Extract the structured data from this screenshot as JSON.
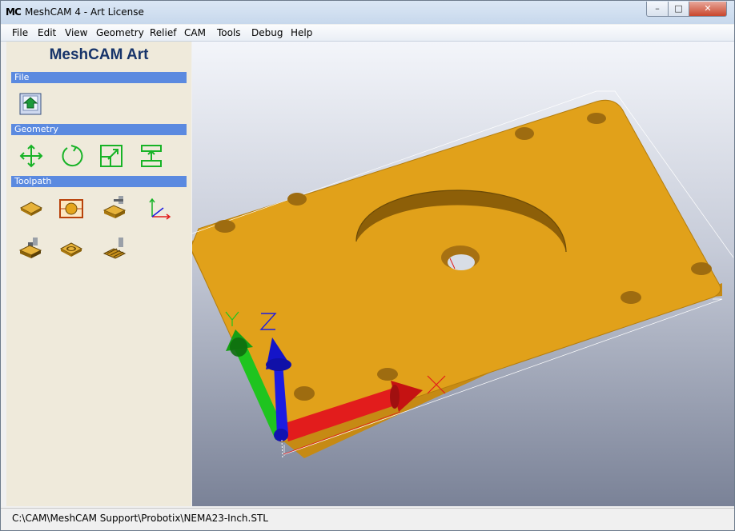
{
  "window": {
    "icon_text": "MC",
    "title": "MeshCAM 4 - Art License",
    "controls": {
      "minimize": "–",
      "maximize": "□",
      "close": "✕"
    }
  },
  "menu": [
    "File",
    "Edit",
    "View",
    "Geometry",
    "Relief",
    "CAM",
    "Tools",
    "Debug",
    "Help"
  ],
  "sidebar": {
    "app_name": "MeshCAM Art",
    "sections": {
      "file": {
        "label": "File",
        "tools": [
          "open-file-icon"
        ]
      },
      "geometry": {
        "label": "Geometry",
        "tools": [
          "move-icon",
          "rotate-icon",
          "scale-icon",
          "set-height-icon"
        ]
      },
      "toolpath": {
        "label": "Toolpath",
        "tools": [
          "stock-icon",
          "machine-region-icon",
          "waterline-icon",
          "set-origin-icon",
          "tool-setup-icon",
          "pocket-icon",
          "calculate-toolpath-icon"
        ]
      }
    }
  },
  "viewport": {
    "axis_labels": {
      "x": "X",
      "y": "Y",
      "z": "Z"
    },
    "colors": {
      "part": "#e1a11a",
      "x_axis": "#e21c1c",
      "y_axis": "#1cc41c",
      "z_axis": "#1c1ce2"
    }
  },
  "status": {
    "path": "C:\\CAM\\MeshCAM Support\\Probotix\\NEMA23-Inch.STL"
  }
}
